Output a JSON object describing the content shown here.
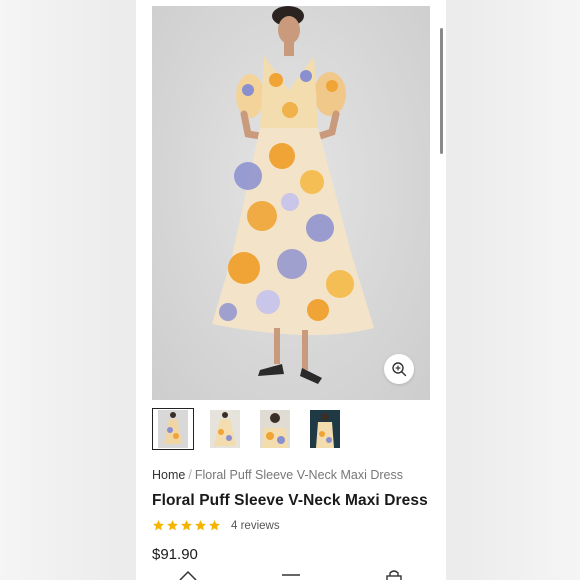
{
  "product": {
    "breadcrumb_home": "Home",
    "breadcrumb_separator": "/",
    "breadcrumb_current": "Floral Puff Sleeve V-Neck Maxi Dress",
    "title": "Floral Puff Sleeve V-Neck Maxi Dress",
    "rating_stars": 5,
    "reviews": "4 reviews",
    "price": "$91.90"
  },
  "gallery": {
    "thumbnails": [
      "thumb-1",
      "thumb-2",
      "thumb-3",
      "thumb-4"
    ],
    "active_index": 0
  },
  "icons": {
    "zoom": "zoom-in-icon",
    "star": "star-icon",
    "nav": [
      "home-icon",
      "menu-icon",
      "bag-icon"
    ]
  },
  "colors": {
    "star": "#f4b400",
    "background": "#ececec",
    "dress_orange": "#f0a436",
    "dress_blue": "#8a8fd0",
    "dress_cream": "#f3e3c8"
  }
}
